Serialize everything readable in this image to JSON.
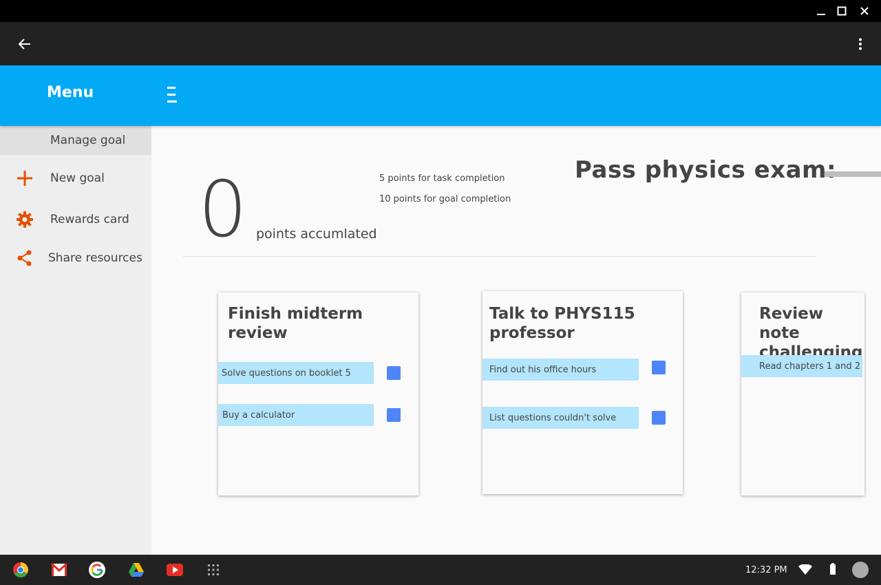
{
  "window": {
    "controls": [
      "minimize-icon",
      "maximize-icon",
      "close-icon"
    ]
  },
  "appbar": {
    "back_icon": "arrow-left-icon",
    "more_icon": "more-vert-icon"
  },
  "header": {
    "menu_title": "Menu",
    "hamburger_icon": "hamburger-icon",
    "color": "#03a9f4"
  },
  "sidebar": {
    "items": [
      {
        "label": "Manage goal",
        "icon": "",
        "active": true
      },
      {
        "label": "New goal",
        "icon": "plus-icon"
      },
      {
        "label": "Rewards card",
        "icon": "gear-icon"
      },
      {
        "label": "Share resources",
        "icon": "share-icon"
      }
    ],
    "accent": "#e65100"
  },
  "points": {
    "value": "0",
    "label": "points accumlated",
    "rules": [
      "5 points for task completion",
      "10 points for goal completion"
    ]
  },
  "goal": {
    "title": "Pass physics exam:"
  },
  "cards": [
    {
      "title": "Finish midterm review",
      "tasks": [
        "Solve questions on booklet 5",
        "Buy a calculator"
      ]
    },
    {
      "title": "Talk to PHYS115 professor",
      "tasks": [
        "Find out his office hours",
        "List questions couldn't solve"
      ]
    },
    {
      "title": "Review note challenging",
      "tasks": [
        "Read chapters 1 and 2"
      ]
    }
  ],
  "shelf": {
    "apps": [
      "chrome-icon",
      "gmail-icon",
      "google-icon",
      "drive-icon",
      "youtube-icon",
      "launcher-icon"
    ],
    "time": "12:32 PM",
    "status_icons": [
      "wifi-icon",
      "battery-icon",
      "account-avatar"
    ]
  }
}
